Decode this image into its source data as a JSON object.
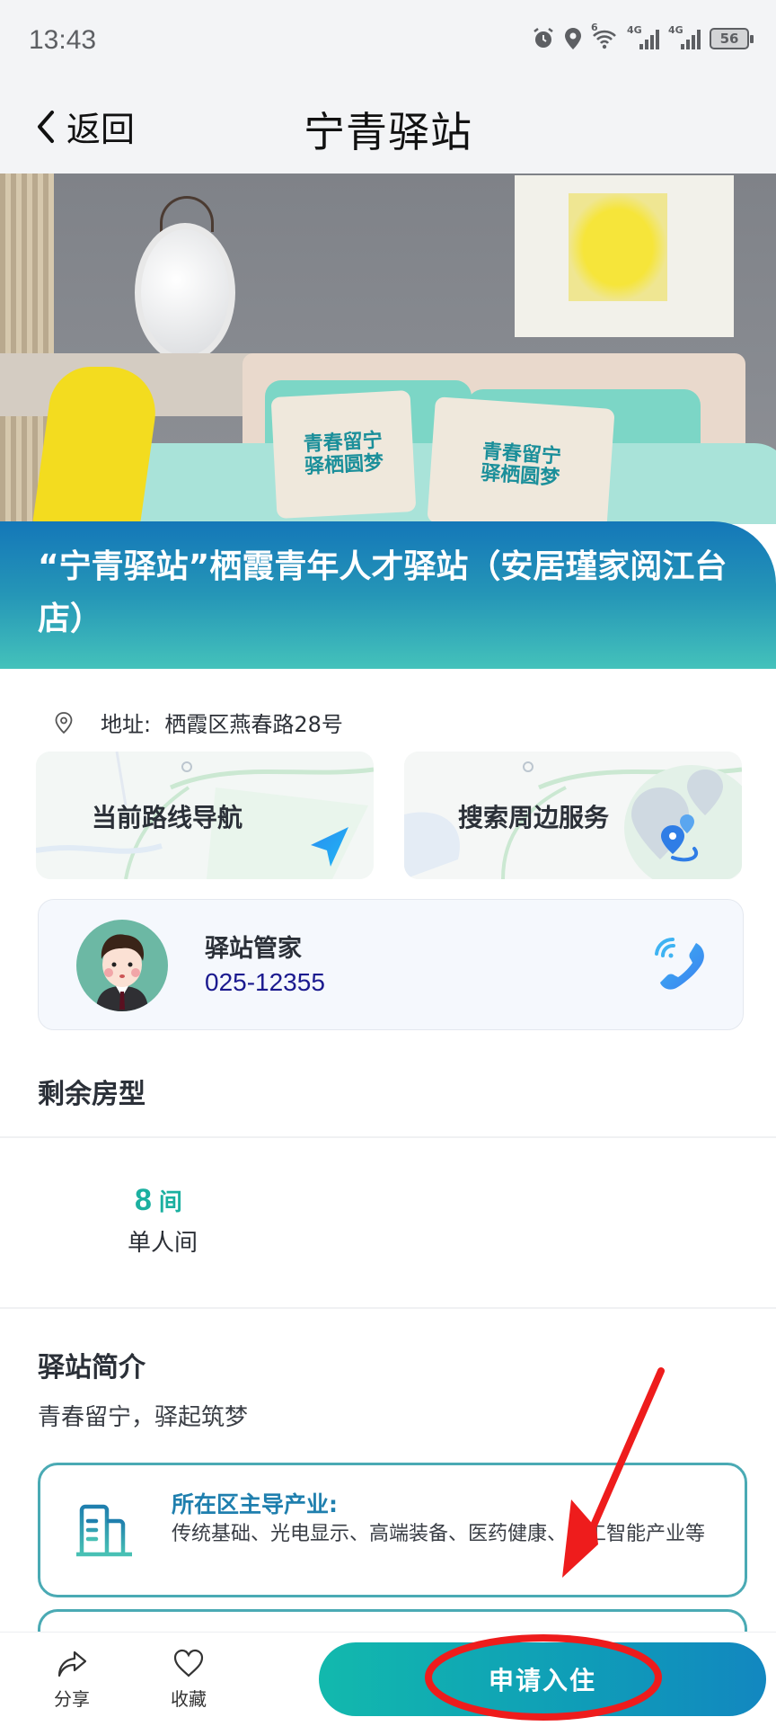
{
  "status_bar": {
    "time": "13:43",
    "icons": [
      "alarm-icon",
      "location-icon",
      "wifi-icon",
      "signal-4g-icon",
      "signal-4g-icon",
      "battery-icon"
    ],
    "wifi_tag": "6",
    "signal_tag": "4G",
    "battery_level": "56"
  },
  "nav": {
    "back_label": "返回",
    "title": "宁青驿站"
  },
  "hero": {
    "cushion_text": "青春留宁\n驿栖圆梦"
  },
  "station": {
    "name": "“宁青驿站”栖霞青年人才驿站（安居瑾家阅江台店）",
    "address_label": "地址:",
    "address": "栖霞区燕春路28号"
  },
  "map_actions": [
    {
      "label": "当前路线导航",
      "icon": "navigation-arrow-icon"
    },
    {
      "label": "搜索周边服务",
      "icon": "nearby-pins-icon"
    }
  ],
  "manager": {
    "title": "驿站管家",
    "phone": "025-12355"
  },
  "rooms": {
    "section_title": "剩余房型",
    "items": [
      {
        "count": "8",
        "unit": "间",
        "type": "单人间"
      }
    ]
  },
  "intro": {
    "section_title": "驿站简介",
    "slogan": "青春留宁，驿起筑梦",
    "industry_title": "所在区主导产业:",
    "industry_desc": "传统基础、光电显示、高端装备、医药健康、人工智能产业等"
  },
  "bottom_bar": {
    "share_label": "分享",
    "favorite_label": "收藏",
    "apply_label": "申请入住"
  },
  "colors": {
    "accent_teal": "#1bb0a0",
    "band_blue": "#1477b8",
    "phone_blue": "#1b1a8f",
    "annotation_red": "#ee1c1c"
  }
}
